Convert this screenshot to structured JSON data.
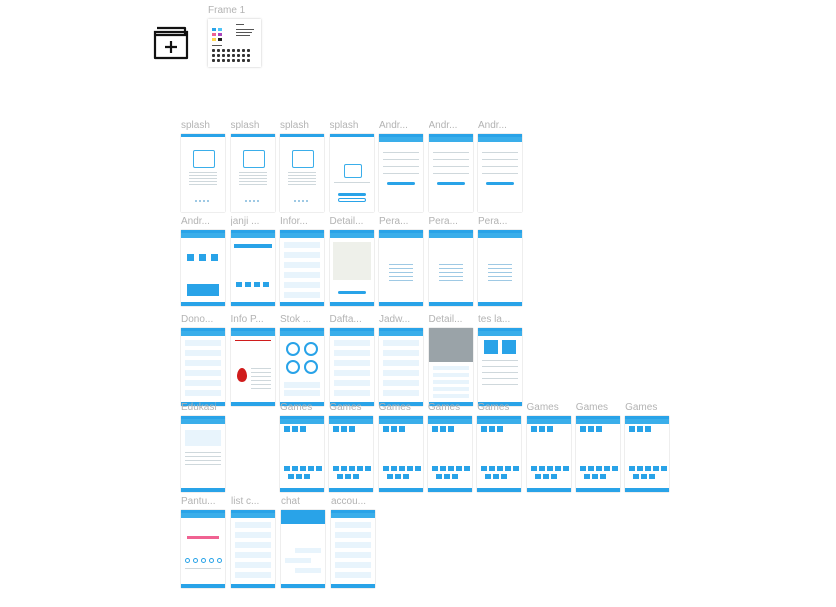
{
  "canvas": {
    "background": "#ffffff",
    "accent": "#29a3e8",
    "label_color": "#b3b3b3"
  },
  "project_icon": {
    "icon": "folder-plus-icon"
  },
  "frame1": {
    "label": "Frame 1"
  },
  "rows": [
    {
      "frames": [
        {
          "label": "splash",
          "kind": "splash"
        },
        {
          "label": "splash",
          "kind": "splash"
        },
        {
          "label": "splash",
          "kind": "splash"
        },
        {
          "label": "splash",
          "kind": "splash-btn"
        },
        {
          "label": "Andr...",
          "kind": "form"
        },
        {
          "label": "Andr...",
          "kind": "form"
        },
        {
          "label": "Andr...",
          "kind": "form"
        }
      ]
    },
    {
      "frames": [
        {
          "label": "Andr...",
          "kind": "home"
        },
        {
          "label": "janji ...",
          "kind": "calendar"
        },
        {
          "label": "Infor...",
          "kind": "list"
        },
        {
          "label": "Detail...",
          "kind": "map"
        },
        {
          "label": "Pera...",
          "kind": "text"
        },
        {
          "label": "Pera...",
          "kind": "text"
        },
        {
          "label": "Pera...",
          "kind": "text"
        }
      ]
    },
    {
      "frames": [
        {
          "label": "Dono...",
          "kind": "list"
        },
        {
          "label": "Info P...",
          "kind": "info"
        },
        {
          "label": "Stok ...",
          "kind": "stock"
        },
        {
          "label": "Dafta...",
          "kind": "list"
        },
        {
          "label": "Jadw...",
          "kind": "list"
        },
        {
          "label": "Detail...",
          "kind": "photo"
        },
        {
          "label": "tes la...",
          "kind": "test"
        }
      ]
    },
    {
      "frames": [
        {
          "label": "Edukasi",
          "kind": "edu"
        },
        {
          "label": "Games",
          "kind": "game"
        },
        {
          "label": "Games",
          "kind": "game"
        },
        {
          "label": "Games",
          "kind": "game"
        },
        {
          "label": "Games",
          "kind": "game"
        },
        {
          "label": "Games",
          "kind": "game"
        },
        {
          "label": "Games",
          "kind": "game"
        },
        {
          "label": "Games",
          "kind": "game"
        },
        {
          "label": "Games",
          "kind": "game"
        }
      ]
    },
    {
      "frames": [
        {
          "label": "Pantu...",
          "kind": "progress"
        },
        {
          "label": "list c...",
          "kind": "list"
        },
        {
          "label": "chat",
          "kind": "chat"
        },
        {
          "label": "accou...",
          "kind": "list"
        }
      ]
    }
  ]
}
